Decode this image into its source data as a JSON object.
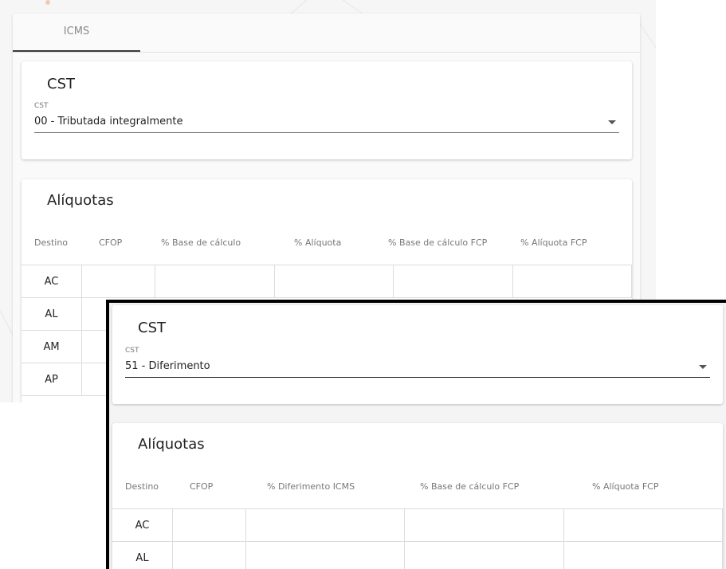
{
  "back": {
    "tab_label": "ICMS",
    "cst_card": {
      "title": "CST",
      "select_label": "CST",
      "select_value": "00 - Tributada integralmente"
    },
    "aliquotas_card": {
      "title": "Alíquotas",
      "columns": [
        "Destino",
        "CFOP",
        "% Base de cálculo",
        "% Alíquota",
        "% Base de cálculo FCP",
        "% Alíquota FCP"
      ],
      "rows": [
        "AC",
        "AL",
        "AM",
        "AP"
      ]
    }
  },
  "front": {
    "cst_card": {
      "title": "CST",
      "select_label": "CST",
      "select_value": "51 - Diferimento"
    },
    "aliquotas_card": {
      "title": "Alíquotas",
      "columns": [
        "Destino",
        "CFOP",
        "% Diferimento ICMS",
        "% Base de cálculo FCP",
        "% Alíquota FCP"
      ],
      "rows": [
        "AC",
        "AL"
      ]
    }
  }
}
